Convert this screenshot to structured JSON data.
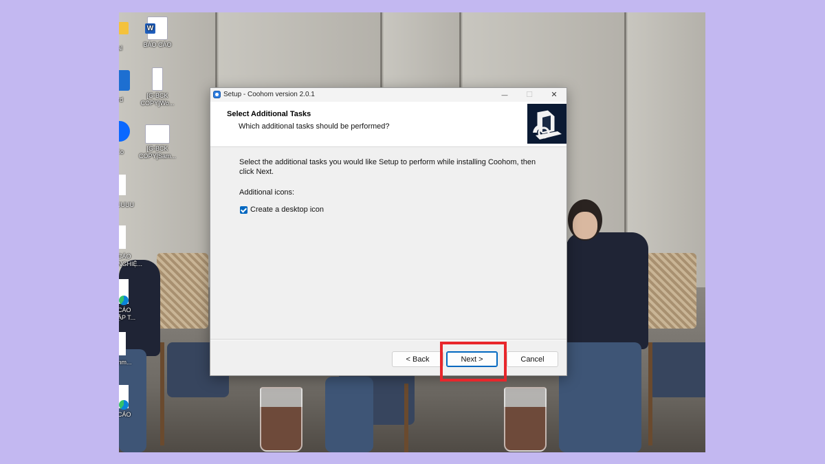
{
  "desktop": {
    "icons": [
      {
        "label": "BÁO CÁO"
      },
      {
        "label": "[G-BCK\nCOPY]Wo..."
      },
      {
        "label": "[G-BCK\nCOPY]Sam..."
      }
    ],
    "edge_labels": [
      "al",
      "rd",
      "lo",
      "UUUU",
      "CÁO\nNGHIỆ...",
      "CÁO\nẬP T...",
      "mm...",
      "CÁO"
    ]
  },
  "dialog": {
    "title": "Setup - Coohom version 2.0.1",
    "header_title": "Select Additional Tasks",
    "header_subtitle": "Which additional tasks should be performed?",
    "description": "Select the additional tasks you would like Setup to perform while installing Coohom, then click Next.",
    "additional_icons_label": "Additional icons:",
    "checkbox_label": "Create a desktop icon",
    "checkbox_checked": true,
    "buttons": {
      "back": "< Back",
      "next": "Next >",
      "cancel": "Cancel"
    },
    "window_controls": {
      "minimize": "—",
      "maximize": "☐",
      "close": "✕"
    }
  },
  "highlight_color": "#e8262b",
  "accent_color": "#0067c0",
  "background_color": "#c3b8f1"
}
